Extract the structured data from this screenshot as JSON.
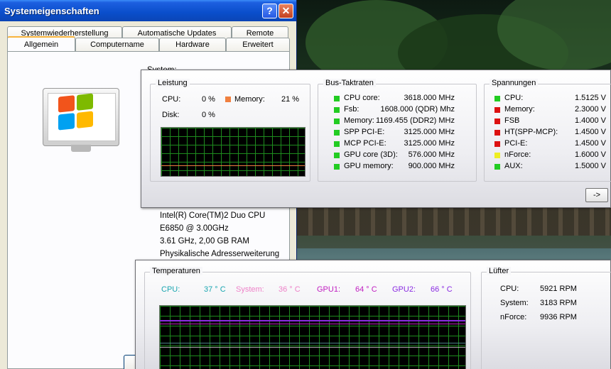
{
  "sysprops": {
    "title": "Systemeigenschaften",
    "help_glyph": "?",
    "close_glyph": "✕",
    "tabs_row1": [
      "Systemwiederherstellung",
      "Automatische Updates",
      "Remote"
    ],
    "tabs_row2": [
      "Allgemein",
      "Computername",
      "Hardware",
      "Erweitert"
    ],
    "active_tab": "Allgemein",
    "system_heading": "System:",
    "cpu_lines": [
      "Intel(R) Core(TM)2 Duo CPU",
      "E6850  @ 3.00GHz",
      "3.61 GHz, 2,00 GB RAM",
      "Physikalische Adresserweiterung"
    ]
  },
  "monitor_top": {
    "leistung": {
      "title": "Leistung",
      "cpu_label": "CPU:",
      "cpu_value": "0 %",
      "memory_label": "Memory:",
      "memory_value": "21 %",
      "disk_label": "Disk:",
      "disk_value": "0 %"
    },
    "bus": {
      "title": "Bus-Taktraten",
      "items": [
        {
          "label": "CPU core:",
          "value": "3618.000 MHz",
          "color": "#22cc22"
        },
        {
          "label": "Fsb:",
          "value": "1608.000 (QDR) Mhz",
          "color": "#22cc22"
        },
        {
          "label": "Memory:",
          "value": "1169.455 (DDR2) MHz",
          "color": "#22cc22"
        },
        {
          "label": "SPP PCI-E:",
          "value": "3125.000 MHz",
          "color": "#22cc22"
        },
        {
          "label": "MCP PCI-E:",
          "value": "3125.000 MHz",
          "color": "#22cc22"
        },
        {
          "label": "GPU core (3D):",
          "value": "576.000 MHz",
          "color": "#22cc22"
        },
        {
          "label": "GPU memory:",
          "value": "900.000 MHz",
          "color": "#22cc22"
        }
      ]
    },
    "spannungen": {
      "title": "Spannungen",
      "items": [
        {
          "label": "CPU:",
          "value": "1.5125 V",
          "color": "#22cc22"
        },
        {
          "label": "Memory:",
          "value": "2.3000 V",
          "color": "#dd1111"
        },
        {
          "label": "FSB",
          "value": "1.4000 V",
          "color": "#dd1111"
        },
        {
          "label": "HT(SPP-MCP):",
          "value": "1.4500 V",
          "color": "#dd1111"
        },
        {
          "label": "PCI-E:",
          "value": "1.4500 V",
          "color": "#dd1111"
        },
        {
          "label": "nForce:",
          "value": "1.6000 V",
          "color": "#eeee22"
        },
        {
          "label": "AUX:",
          "value": "1.5000 V",
          "color": "#22cc22"
        }
      ]
    },
    "next_label": "->"
  },
  "monitor_bottom": {
    "temperaturen": {
      "title": "Temperaturen",
      "items": [
        {
          "label": "CPU:",
          "value": "37 ° C",
          "color": "#1aa6b0"
        },
        {
          "label": "System:",
          "value": "36 ° C",
          "color": "#ee82c8"
        },
        {
          "label": "GPU1:",
          "value": "64 ° C",
          "color": "#c01ec0"
        },
        {
          "label": "GPU2:",
          "value": "66 ° C",
          "color": "#8a2be2"
        }
      ]
    },
    "luefter": {
      "title": "Lüfter",
      "items": [
        {
          "label": "CPU:",
          "value": "5921 RPM"
        },
        {
          "label": "System:",
          "value": "3183 RPM"
        },
        {
          "label": "nForce:",
          "value": "9936 RPM"
        }
      ]
    }
  },
  "colors": {
    "memory_swatch": "#f08040",
    "graph_grid": "#1e8c1e",
    "titlebar": "#0a4ecb"
  }
}
